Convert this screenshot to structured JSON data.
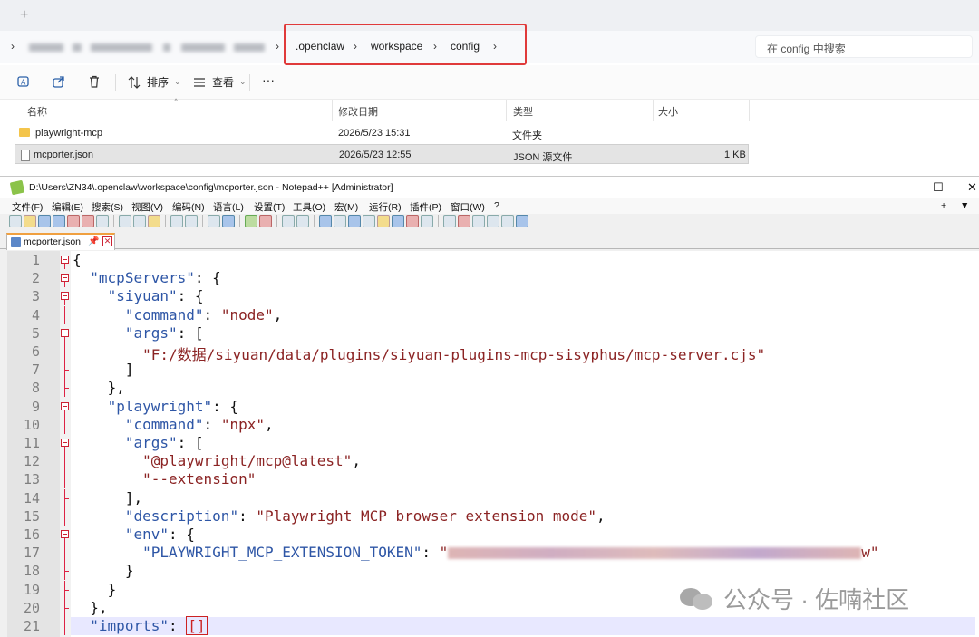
{
  "explorer": {
    "new_tab": "+",
    "breadcrumbs": [
      ".openclaw",
      "workspace",
      "config"
    ],
    "search_placeholder": "在 config 中搜索",
    "toolbar": {
      "sort": "排序",
      "view": "查看",
      "more": "···"
    },
    "columns": {
      "name": "名称",
      "modified": "修改日期",
      "type": "类型",
      "size": "大小"
    },
    "files": [
      {
        "name": ".playwright-mcp",
        "modified": "2026/5/23 15:31",
        "type": "文件夹",
        "size": ""
      },
      {
        "name": "mcporter.json",
        "modified": "2026/5/23 12:55",
        "type": "JSON 源文件",
        "size": "1 KB"
      }
    ]
  },
  "notepad": {
    "title": "D:\\Users\\ZN34\\.openclaw\\workspace\\config\\mcporter.json - Notepad++ [Administrator]",
    "window_controls": {
      "minimize": "–",
      "maximize": "☐",
      "close": "✕"
    },
    "menu": [
      "文件(F)",
      "编辑(E)",
      "搜索(S)",
      "视图(V)",
      "编码(N)",
      "语言(L)",
      "设置(T)",
      "工具(O)",
      "宏(M)",
      "运行(R)",
      "插件(P)",
      "窗口(W)",
      "?"
    ],
    "menu_right": [
      "+",
      "▼"
    ],
    "tab": {
      "label": "mcporter.json",
      "pin": "📌",
      "close": "✕"
    },
    "lines": [
      "{",
      "  \"mcpServers\": {",
      "    \"siyuan\": {",
      "      \"command\": \"node\",",
      "      \"args\": [",
      "        \"F:/数据/siyuan/data/plugins/siyuan-plugins-mcp-sisyphus/mcp-server.cjs\"",
      "      ]",
      "    },",
      "    \"playwright\": {",
      "      \"command\": \"npx\",",
      "      \"args\": [",
      "        \"@playwright/mcp@latest\",",
      "        \"--extension\"",
      "      ],",
      "      \"description\": \"Playwright MCP browser extension mode\",",
      "      \"env\": {",
      "        \"PLAYWRIGHT_MCP_EXTENSION_TOKEN\": \"",
      "      }",
      "    }",
      "  },",
      "  \"imports\": []"
    ],
    "token_tail": "w\""
  },
  "watermark": "公众号 · 佐喃社区"
}
